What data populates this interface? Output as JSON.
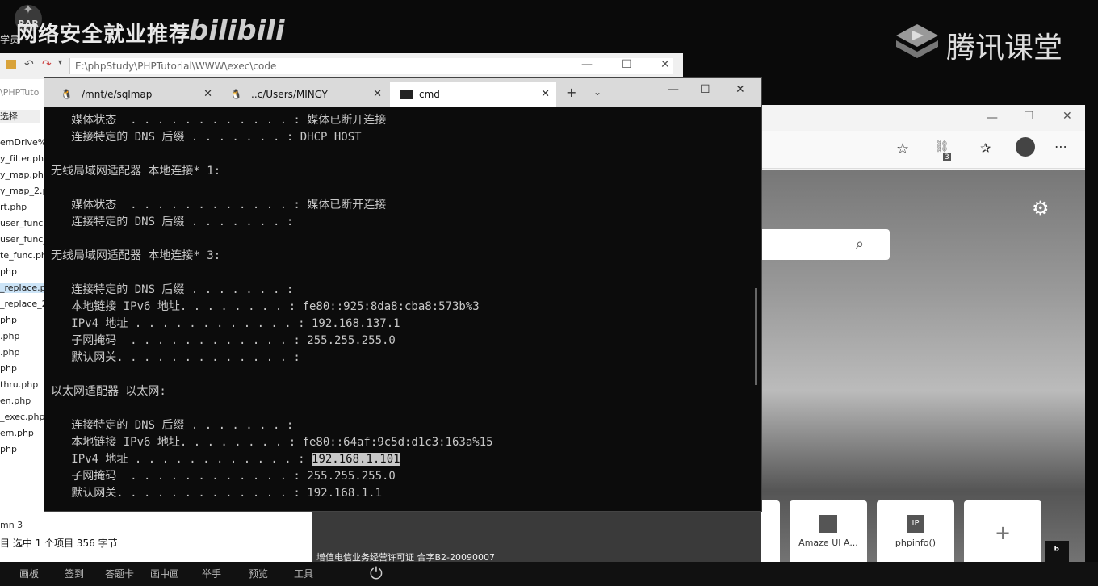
{
  "overlay": {
    "title": "网络安全就业推荐",
    "logo_text": "bilibili",
    "rar_label": "RAR",
    "student_label": "学员",
    "tencent_text": "腾讯课堂"
  },
  "explorer": {
    "path": "E:\\phpStudy\\PHPTutorial\\WWW\\exec\\code",
    "side_label_1": "\\PHPTuto",
    "side_label_2": "选择",
    "files": [
      "emDrive%",
      "y_filter.php",
      "y_map.php",
      "y_map_2.p",
      "rt.php",
      "user_func.",
      "user_func_",
      "te_func.ph",
      "php",
      "_replace.p",
      "_replace_2",
      "php",
      ".php",
      ".php",
      "php",
      "thru.php",
      "en.php",
      "_exec.php",
      "em.php",
      "php"
    ],
    "status": "目   选中 1 个项目  356 字节",
    "status_extra": "mn 3"
  },
  "cmd": {
    "tabs": [
      {
        "label": "/mnt/e/sqlmap"
      },
      {
        "label": "..c/Users/MINGY"
      },
      {
        "label": "cmd"
      }
    ],
    "lines": [
      "   媒体状态  . . . . . . . . . . . . : 媒体已断开连接",
      "   连接特定的 DNS 后缀 . . . . . . . : DHCP HOST",
      "",
      "无线局域网适配器 本地连接* 1:",
      "",
      "   媒体状态  . . . . . . . . . . . . : 媒体已断开连接",
      "   连接特定的 DNS 后缀 . . . . . . . :",
      "",
      "无线局域网适配器 本地连接* 3:",
      "",
      "   连接特定的 DNS 后缀 . . . . . . . :",
      "   本地链接 IPv6 地址. . . . . . . . : fe80::925:8da8:cba8:573b%3",
      "   IPv4 地址 . . . . . . . . . . . . : 192.168.137.1",
      "   子网掩码  . . . . . . . . . . . . : 255.255.255.0",
      "   默认网关. . . . . . . . . . . . . :",
      "",
      "以太网适配器 以太网:",
      "",
      "   连接特定的 DNS 后缀 . . . . . . . :",
      "   本地链接 IPv6 地址. . . . . . . . : fe80::64af:9c5d:d1c3:163a%15",
      "   IPv4 地址 . . . . . . . . . . . . : ",
      "   子网掩码  . . . . . . . . . . . . : 255.255.255.0",
      "   默认网关. . . . . . . . . . . . . : 192.168.1.1"
    ],
    "selected_ip": "192.168.1.101"
  },
  "browser": {
    "tiles": [
      {
        "label": "Amaze UI A..."
      },
      {
        "label": "phpinfo()"
      },
      {
        "label": ""
      }
    ],
    "tile_icon_ip": "IP",
    "badge_count": "3",
    "license": "增值电信业务经营许可证 合字B2-20090007"
  },
  "taskbar": {
    "items": [
      "画板",
      "签到",
      "答题卡",
      "画中画",
      "举手",
      "预览",
      "工具"
    ]
  }
}
